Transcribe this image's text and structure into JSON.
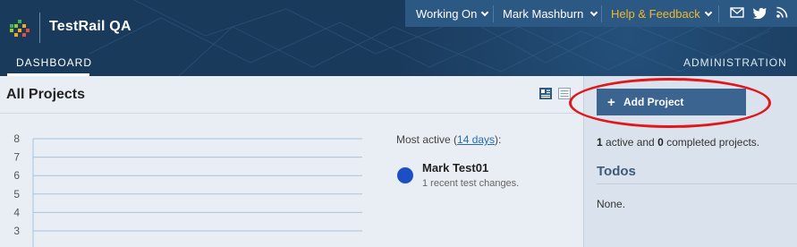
{
  "header": {
    "brand": "TestRail QA",
    "topbar": {
      "working_on": "Working On",
      "user": "Mark Mashburn",
      "help": "Help & Feedback",
      "icons": [
        "mail-icon",
        "twitter-icon",
        "rss-icon"
      ]
    },
    "tabs": {
      "dashboard": "DASHBOARD",
      "administration": "ADMINISTRATION"
    }
  },
  "main": {
    "title": "All Projects",
    "view_icons": [
      "compact-view-icon",
      "list-view-icon"
    ],
    "most_active_prefix": "Most active (",
    "most_active_link": "14 days",
    "most_active_suffix": "):",
    "project": {
      "name": "Mark Test01",
      "changes": "1 recent test changes.",
      "color": "#1d4fc4"
    }
  },
  "sidebar": {
    "add_project": "Add Project",
    "summary_active_count": "1",
    "summary_active_text": " active and ",
    "summary_completed_count": "0",
    "summary_completed_text": " completed projects.",
    "todos_title": "Todos",
    "todos_none": "None."
  },
  "chart_data": {
    "type": "line",
    "y_ticks": [
      "8",
      "7",
      "6",
      "5",
      "4",
      "3"
    ],
    "ylim": [
      3,
      8
    ],
    "grid": true,
    "series": []
  },
  "colors": {
    "header_bg": "#1a3a5c",
    "topbar_bg": "#2c5884",
    "help_accent": "#f0b82d",
    "button_bg": "#3b6490",
    "annotation_red": "#e0181b"
  }
}
